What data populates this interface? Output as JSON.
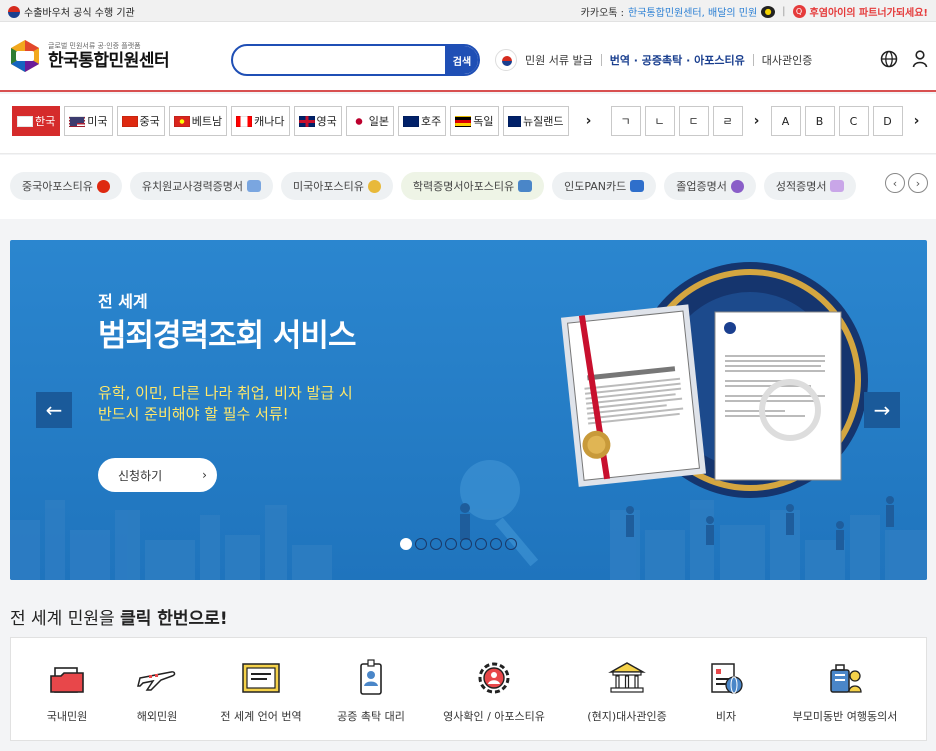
{
  "topbar": {
    "official_label": "수출바우처 공식 수행 기관",
    "kakao_label": "카카오톡 :",
    "kakao_link": "한국통합민원센터, 배달의 민원",
    "partner": "후염아이의 파트너가되세요!"
  },
  "header": {
    "logo_sub": "글로벌 민원서류 공·인증 플랫폼",
    "logo_title": "한국통합민원센터",
    "logo_badge": "민원",
    "search_placeholder": "",
    "search_button": "검색",
    "nav": [
      {
        "label": "민원 서류 발급",
        "bold": false
      },
      {
        "label": "번역 · 공증촉탁 · 아포스티유",
        "bold": true
      },
      {
        "label": "대사관인증",
        "bold": false
      }
    ]
  },
  "countries": [
    {
      "label": "한국",
      "colors": [
        "#ffffff",
        "#d52b1e"
      ]
    },
    {
      "label": "미국",
      "colors": [
        "#b22234",
        "#3c3b6e"
      ]
    },
    {
      "label": "중국",
      "colors": [
        "#de2910",
        "#ffde00"
      ]
    },
    {
      "label": "베트남",
      "colors": [
        "#da251d",
        "#ffff00"
      ]
    },
    {
      "label": "캐나다",
      "colors": [
        "#ff0000",
        "#ffffff"
      ]
    },
    {
      "label": "영국",
      "colors": [
        "#012169",
        "#c8102e"
      ]
    },
    {
      "label": "일본",
      "colors": [
        "#ffffff",
        "#bc002d"
      ]
    },
    {
      "label": "호주",
      "colors": [
        "#012169",
        "#ffffff"
      ]
    },
    {
      "label": "독일",
      "colors": [
        "#000000",
        "#dd0000"
      ]
    },
    {
      "label": "뉴질랜드",
      "colors": [
        "#012169",
        "#cc142b"
      ]
    }
  ],
  "letters": [
    "ㄱ",
    "ㄴ",
    "ㄷ",
    "ㄹ",
    "A",
    "B",
    "C",
    "D"
  ],
  "chips": [
    {
      "label": "중국아포스티유",
      "alt": false,
      "color": "#de2910"
    },
    {
      "label": "유치원교사경력증명서",
      "alt": false,
      "color": "#7aa6e0"
    },
    {
      "label": "미국아포스티유",
      "alt": false,
      "color": "#e8b93a"
    },
    {
      "label": "학력증명서아포스티유",
      "alt": true,
      "color": "#4a86c8"
    },
    {
      "label": "인도PAN카드",
      "alt": false,
      "color": "#2f6fcb"
    },
    {
      "label": "졸업증명서",
      "alt": false,
      "color": "#8a5ec8"
    },
    {
      "label": "성적증명서",
      "alt": false,
      "color": "#c9a6e8"
    }
  ],
  "hero": {
    "sup": "전 세계",
    "title": "범죄경력조회 서비스",
    "desc1": "유학, 이민, 다른 나라 취업, 비자 발급 시",
    "desc2": "반드시 준비해야 할 필수 서류!",
    "apply": "신청하기",
    "slide_count": 8,
    "active_slide": 0
  },
  "section": {
    "title_plain": "전 세계 민원을 ",
    "title_bold": "클릭 한번으로!"
  },
  "services": [
    {
      "label": "국내민원",
      "icon": "folder-icon"
    },
    {
      "label": "해외민원",
      "icon": "airplane-icon"
    },
    {
      "label": "전 세계 언어 번역",
      "icon": "translation-icon"
    },
    {
      "label": "공증 촉탁 대리",
      "icon": "id-badge-icon"
    },
    {
      "label": "영사확인 / 아포스티유",
      "icon": "gear-person-icon"
    },
    {
      "label": "(현지)대사관인증",
      "icon": "embassy-icon"
    },
    {
      "label": "비자",
      "icon": "visa-icon"
    },
    {
      "label": "부모미동반 여행동의서",
      "icon": "luggage-icon"
    }
  ]
}
